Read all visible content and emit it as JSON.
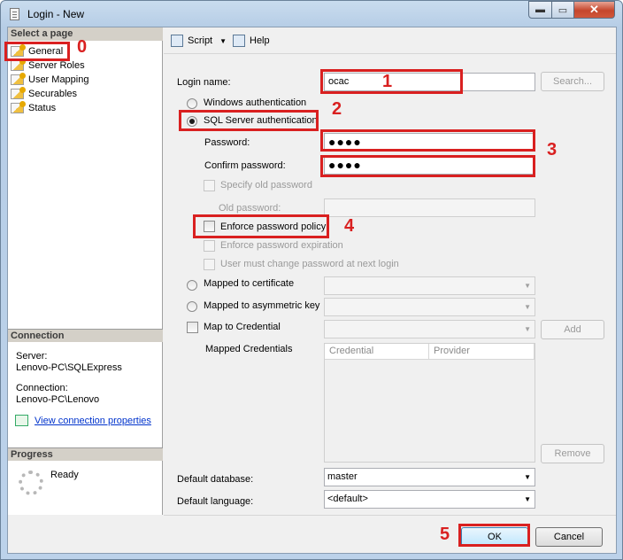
{
  "window": {
    "title": "Login - New",
    "min_glyph": "▬",
    "max_glyph": "▭",
    "close_glyph": "✕"
  },
  "left_pane": {
    "select_page_header": "Select a page",
    "pages": [
      "General",
      "Server Roles",
      "User Mapping",
      "Securables",
      "Status"
    ],
    "connection_header": "Connection",
    "server_label": "Server:",
    "server_value": "Lenovo-PC\\SQLExpress",
    "connection_label": "Connection:",
    "connection_value": "Lenovo-PC\\Lenovo",
    "view_connection_link": "View connection properties",
    "progress_header": "Progress",
    "progress_status": "Ready"
  },
  "toolbar": {
    "script_label": "Script",
    "help_label": "Help"
  },
  "general": {
    "login_name_label": "Login name:",
    "login_name_value": "ocac",
    "search_button": "Search...",
    "windows_auth_label": "Windows authentication",
    "sql_auth_label": "SQL Server authentication",
    "auth_selected": "sql",
    "password_label": "Password:",
    "password_value": "●●●●",
    "confirm_password_label": "Confirm password:",
    "confirm_password_value": "●●●●",
    "specify_old_password_label": "Specify old password",
    "old_password_label": "Old password:",
    "enforce_policy_label": "Enforce password policy",
    "enforce_expiration_label": "Enforce password expiration",
    "must_change_label": "User must change password at next login",
    "mapped_certificate_label": "Mapped to certificate",
    "mapped_asym_key_label": "Mapped to asymmetric key",
    "map_credential_label": "Map to Credential",
    "add_button": "Add",
    "mapped_credentials_label": "Mapped Credentials",
    "credentials_columns": [
      "Credential",
      "Provider"
    ],
    "remove_button": "Remove",
    "default_database_label": "Default database:",
    "default_database_value": "master",
    "default_language_label": "Default language:",
    "default_language_value": "<default>"
  },
  "footer": {
    "ok_button": "OK",
    "cancel_button": "Cancel"
  },
  "annotations": {
    "n0": "0",
    "n1": "1",
    "n2": "2",
    "n3": "3",
    "n4": "4",
    "n5": "5",
    "color": "#d92020"
  }
}
